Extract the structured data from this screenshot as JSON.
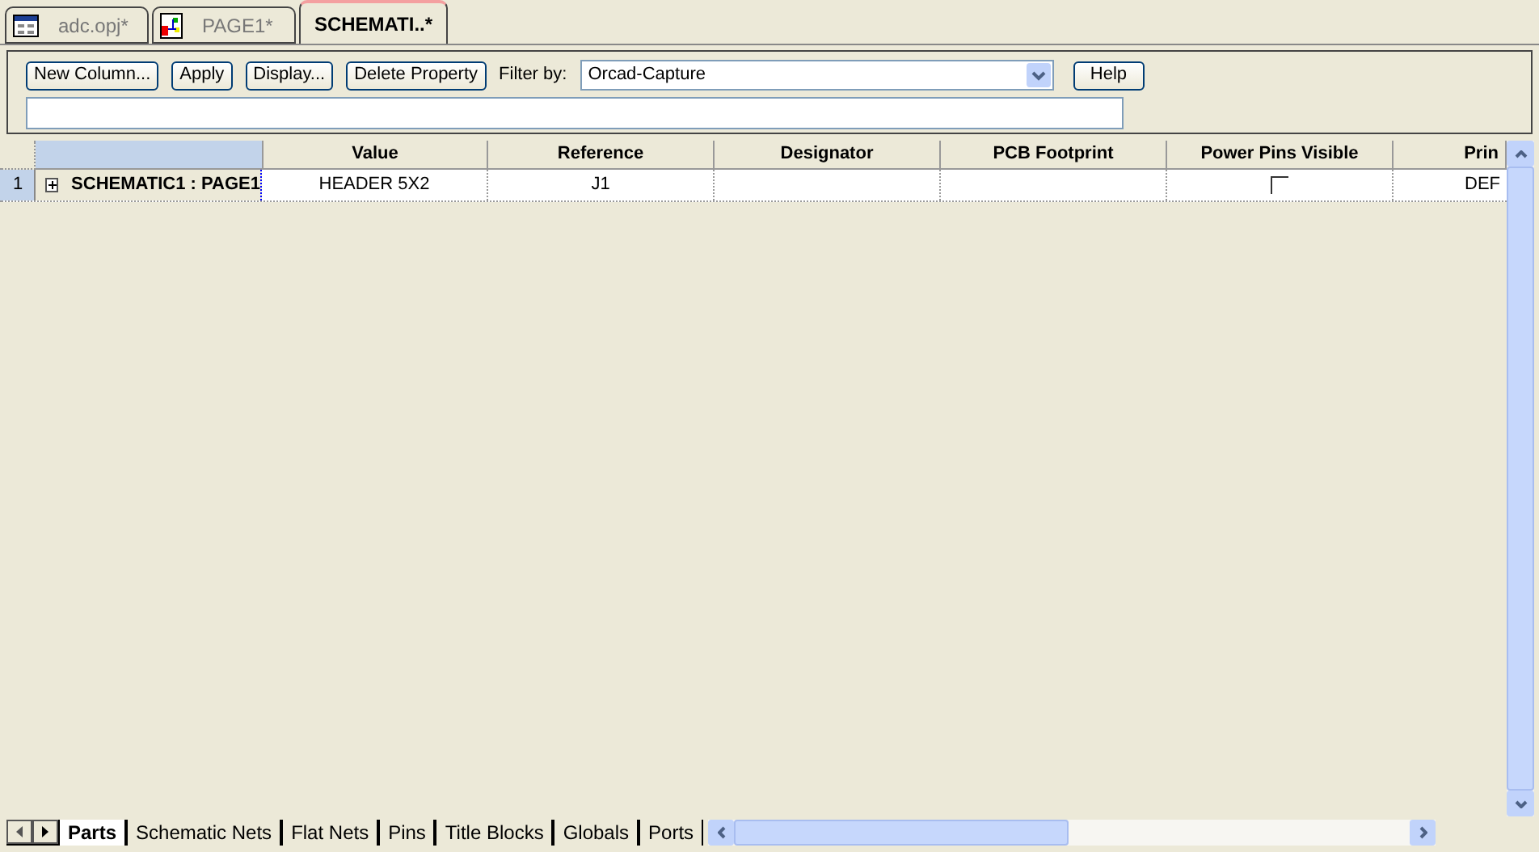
{
  "doc_tabs": [
    {
      "label": "adc.opj*",
      "kind": "project",
      "selected": false
    },
    {
      "label": "PAGE1*",
      "kind": "page",
      "selected": false
    },
    {
      "label": "SCHEMATI..*",
      "kind": "none",
      "selected": true
    }
  ],
  "toolbar": {
    "buttons": [
      "New Column...",
      "Apply",
      "Display...",
      "Delete Property"
    ],
    "filter_label": "Filter by:",
    "filter_value": "Orcad-Capture",
    "help": "Help"
  },
  "table": {
    "columns": [
      "Value",
      "Reference",
      "Designator",
      "PCB Footprint",
      "Power Pins Visible",
      "Prin"
    ],
    "rows": [
      {
        "number": "1",
        "name": "SCHEMATIC1 : PAGE1",
        "expanded": false,
        "cells": [
          "HEADER 5X2",
          "J1",
          "",
          ""
        ],
        "power_pins_visible": false,
        "last": "DEF"
      }
    ]
  },
  "sheet_tabs": [
    {
      "label": "Parts",
      "selected": true
    },
    {
      "label": "Schematic Nets",
      "selected": false
    },
    {
      "label": "Flat Nets",
      "selected": false
    },
    {
      "label": "Pins",
      "selected": false
    },
    {
      "label": "Title Blocks",
      "selected": false
    },
    {
      "label": "Globals",
      "selected": false
    },
    {
      "label": "Ports",
      "selected": false
    }
  ]
}
